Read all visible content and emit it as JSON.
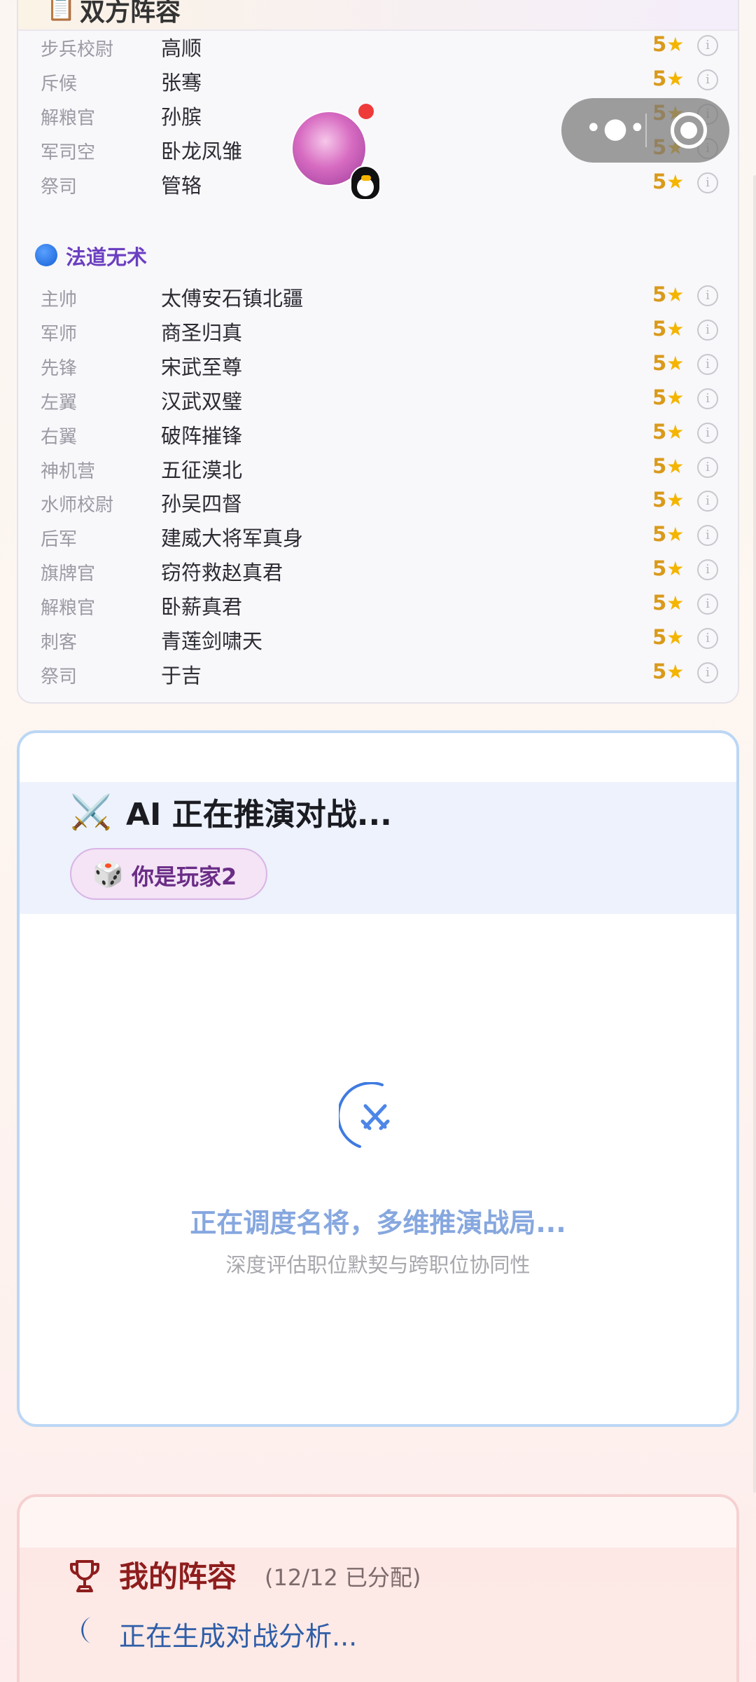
{
  "roster": {
    "header_icon": "clipboard-icon",
    "header_title": "双方阵容",
    "top_rows": [
      {
        "role": "步兵校尉",
        "name": "高顺",
        "rating": "5"
      },
      {
        "role": "斥候",
        "name": "张骞",
        "rating": "5"
      },
      {
        "role": "解粮官",
        "name": "孙膑",
        "rating": "5"
      },
      {
        "role": "军司空",
        "name": "卧龙凤雏",
        "rating": "5"
      },
      {
        "role": "祭司",
        "name": "管辂",
        "rating": "5"
      }
    ],
    "section": {
      "title": "法道无术",
      "dot_color": "#1f6fe0"
    },
    "section_rows": [
      {
        "role": "主帅",
        "name": "太傅安石镇北疆",
        "rating": "5"
      },
      {
        "role": "军师",
        "name": "商圣归真",
        "rating": "5"
      },
      {
        "role": "先锋",
        "name": "宋武至尊",
        "rating": "5"
      },
      {
        "role": "左翼",
        "name": "汉武双璧",
        "rating": "5"
      },
      {
        "role": "右翼",
        "name": "破阵摧锋",
        "rating": "5"
      },
      {
        "role": "神机营",
        "name": "五征漠北",
        "rating": "5"
      },
      {
        "role": "水师校尉",
        "name": "孙吴四督",
        "rating": "5"
      },
      {
        "role": "后军",
        "name": "建威大将军真身",
        "rating": "5"
      },
      {
        "role": "旗牌官",
        "name": "窃符救赵真君",
        "rating": "5"
      },
      {
        "role": "解粮官",
        "name": "卧薪真君",
        "rating": "5"
      },
      {
        "role": "刺客",
        "name": "青莲剑啸天",
        "rating": "5"
      },
      {
        "role": "祭司",
        "name": "于吉",
        "rating": "5"
      }
    ],
    "star_glyph": "★",
    "info_glyph": "i"
  },
  "ai_panel": {
    "title": "AI 正在推演对战...",
    "player_badge": "你是玩家2",
    "loading_text": "正在调度名将，多维推演战局...",
    "loading_sub": "深度评估职位默契与跨职位协同性"
  },
  "my_lineup": {
    "title": "我的阵容",
    "count": "(12/12 已分配)",
    "status": "正在生成对战分析..."
  },
  "capsule": {
    "more_glyph": "•●•"
  },
  "colors": {
    "accent_purple": "#6b3fc1",
    "star_gold": "#d99a1b",
    "loading_blue": "#86a7df",
    "lineup_red": "#8e1d1d"
  }
}
